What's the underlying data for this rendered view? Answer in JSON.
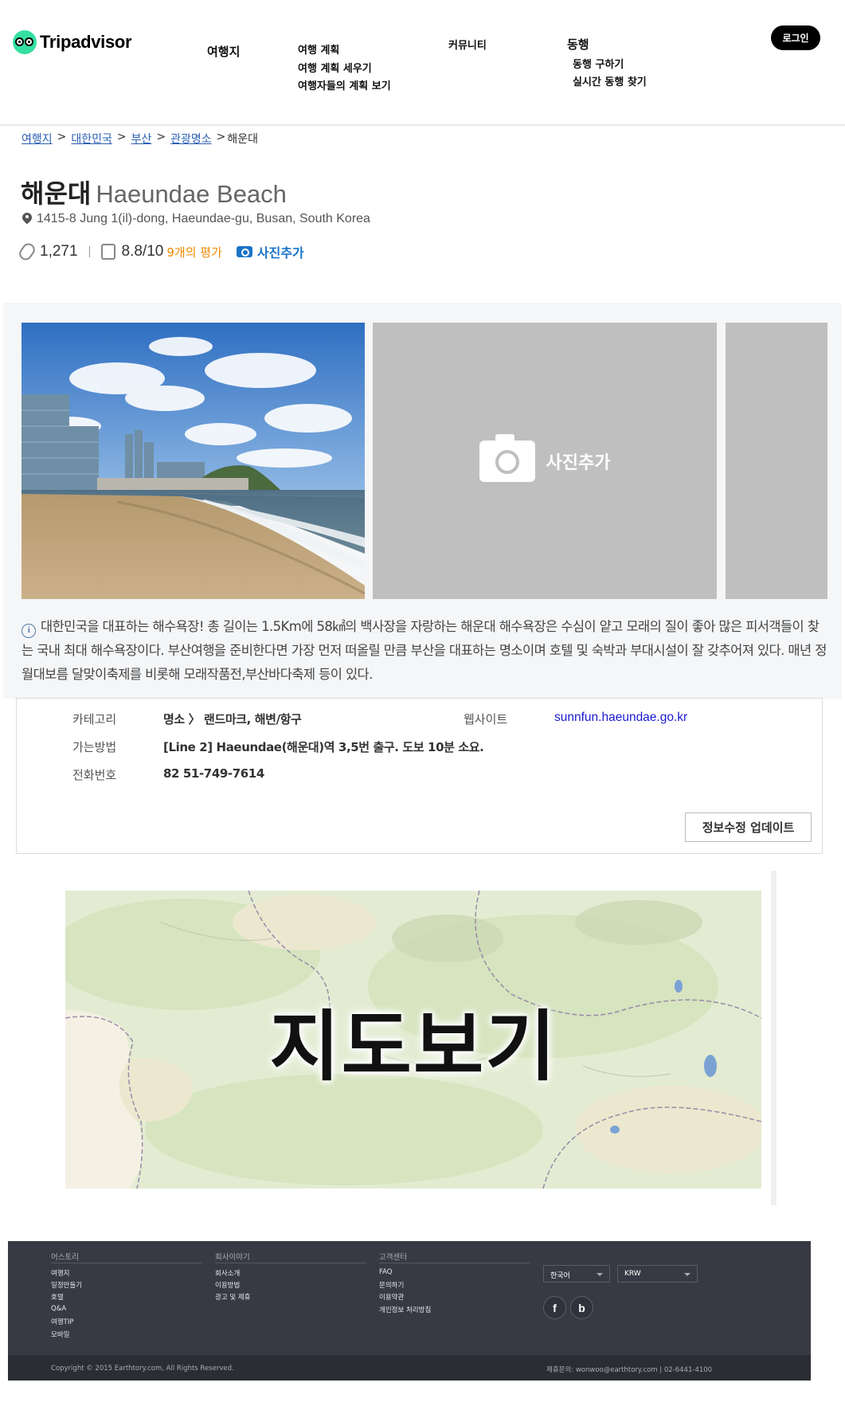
{
  "header": {
    "logo_text": "Tripadvisor",
    "nav_destinations": "여행지",
    "nav_plan": "여행 계획",
    "nav_plan_make": "여행 계획 세우기",
    "nav_plan_view": "여행자들의 계획 보기",
    "nav_community": "커뮤니티",
    "nav_companion": "동행",
    "nav_companion_find": "동행 구하기",
    "nav_companion_live": "실시간 동행 찾기",
    "login_label": "로그인"
  },
  "breadcrumb": {
    "items": [
      "여행지",
      "대한민국",
      "부산",
      "관광명소"
    ],
    "current": "해운대"
  },
  "place": {
    "title_ko": "해운대",
    "title_en": "Haeundae Beach",
    "address": "1415-8 Jung 1(il)-dong, Haeundae-gu, Busan, South Korea",
    "clip_count": "1,271",
    "rating": "8.8/10",
    "rating_count": "9개의 평가",
    "add_photo_label": "사진추가"
  },
  "gallery": {
    "add_photo_label": "사진추가"
  },
  "description": "대한민국을 대표하는 해수욕장! 총 길이는 1.5Km에 58㎢의 백사장을 자랑하는 해운대 해수욕장은 수심이 얕고 모래의 질이 좋아 많은 피서객들이 찾는 국내 최대 해수욕장이다. 부산여행을 준비한다면 가장 먼저 떠올릴 만큼 부산을 대표하는 명소이며 호텔 및 숙박과 부대시설이 잘 갖추어져 있다. 매년 정월대보름 달맞이축제를 비롯해 모래작품전,부산바다축제 등이 있다.",
  "info": {
    "category_label": "카테고리",
    "category_value": "명소 〉 랜드마크, 해변/항구",
    "website_label": "웹사이트",
    "website_value": "sunnfun.haeundae.go.kr",
    "directions_label": "가는방법",
    "directions_value": "[Line 2] Haeundae(해운대)역 3,5번 출구. 도보 10분 소요.",
    "phone_label": "전화번호",
    "phone_value": "82 51-749-7614",
    "update_button": "정보수정 업데이트"
  },
  "map": {
    "label": "지도보기"
  },
  "footer": {
    "col1_title": "어스토리",
    "col1_items": [
      "여행지",
      "일정만들기",
      "호텔",
      "Q&A",
      "여행TIP",
      "모바일"
    ],
    "col2_title": "회사이야기",
    "col2_items": [
      "회사소개",
      "이용방법",
      "광고 및 제휴"
    ],
    "col3_title": "고객센터",
    "col3_items": [
      "FAQ",
      "문의하기",
      "이용약관",
      "개인정보 처리방침"
    ],
    "language": "한국어",
    "currency": "KRW",
    "copyright": "Copyright © 2015 Earthtory.com, All Rights Reserved.",
    "contact": "제휴문의: wonwoo@earthtory.com | 02-6441-4100"
  }
}
